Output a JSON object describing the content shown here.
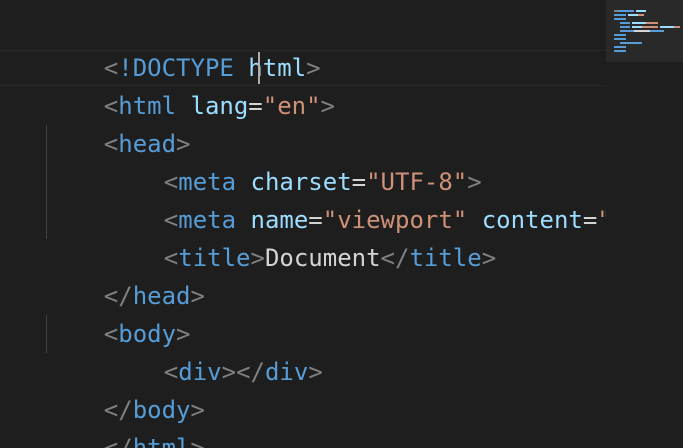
{
  "editor": {
    "lines": [
      {
        "bracket_open": "<",
        "keyword": "!DOCTYPE",
        "space": " ",
        "name": "html",
        "bracket_close": ">"
      },
      {
        "open": "<",
        "tag": "html",
        "attr": "lang",
        "eq": "=",
        "value": "\"en\"",
        "close": ">"
      },
      {
        "open": "<",
        "tag": "head",
        "close": ">"
      },
      {
        "open": "<",
        "tag": "meta",
        "attr": "charset",
        "eq": "=",
        "value": "\"UTF-8\"",
        "close": ">"
      },
      {
        "open": "<",
        "tag": "meta",
        "attr": "name",
        "eq": "=",
        "value": "\"viewport\"",
        "attr2": "content",
        "eq2": "=",
        "value2": "\"wi"
      },
      {
        "open": "<",
        "tag": "title",
        "close": ">",
        "text": "Document",
        "open2": "</",
        "tag2": "title",
        "close2": ">"
      },
      {
        "open": "</",
        "tag": "head",
        "close": ">"
      },
      {
        "open": "<",
        "tag": "body",
        "close": ">"
      },
      {
        "open": "<",
        "tag": "div",
        "close": ">",
        "open2": "</",
        "tag2": "div",
        "close2": ">"
      },
      {
        "open": "</",
        "tag": "body",
        "close": ">"
      },
      {
        "open": "</",
        "tag": "html",
        "close": ">"
      }
    ]
  },
  "colors": {
    "background": "#1e1e1e",
    "punctuation": "#808080",
    "tag": "#569cd6",
    "attribute": "#9cdcfe",
    "string": "#ce9178",
    "text": "#d4d4d4"
  },
  "minimap": {
    "visible": true
  }
}
